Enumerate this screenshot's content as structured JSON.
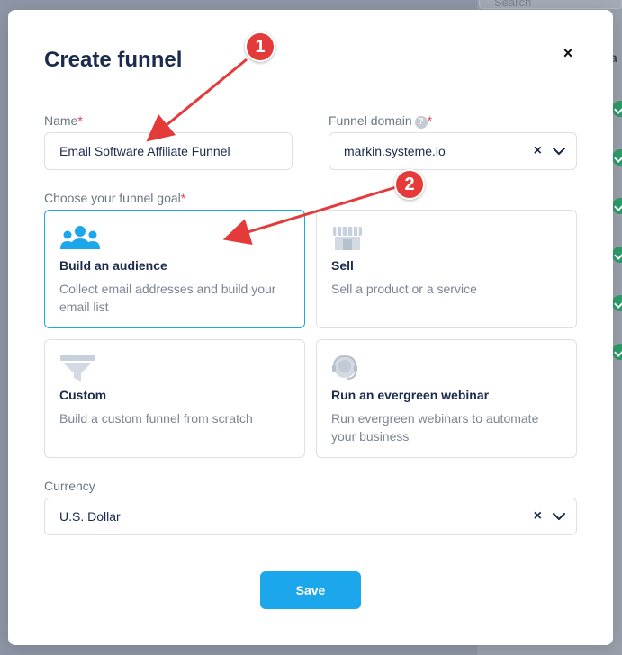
{
  "backdrop": {
    "search_placeholder": "Search",
    "partial_letter": "a"
  },
  "modal": {
    "title": "Create funnel",
    "close_glyph": "×"
  },
  "name_field": {
    "label": "Name",
    "required_mark": "*",
    "value": "Email Software Affiliate Funnel"
  },
  "domain_field": {
    "label": "Funnel domain",
    "help_glyph": "?",
    "required_mark": "*",
    "value": "markin.systeme.io",
    "clear_glyph": "×"
  },
  "goal": {
    "label": "Choose your funnel goal",
    "required_mark": "*",
    "options": [
      {
        "title": "Build an audience",
        "description": "Collect email addresses and build your email list",
        "icon": "audience-icon",
        "selected": true
      },
      {
        "title": "Sell",
        "description": "Sell a product or a service",
        "icon": "shop-icon",
        "selected": false
      },
      {
        "title": "Custom",
        "description": "Build a custom funnel from scratch",
        "icon": "funnel-icon",
        "selected": false
      },
      {
        "title": "Run an evergreen webinar",
        "description": "Run evergreen webinars to automate your business",
        "icon": "headset-icon",
        "selected": false
      }
    ]
  },
  "currency_field": {
    "label": "Currency",
    "value": "U.S. Dollar",
    "clear_glyph": "×"
  },
  "save_label": "Save",
  "annotations": [
    {
      "number": "1"
    },
    {
      "number": "2"
    }
  ],
  "colors": {
    "accent": "#1ca7ec",
    "selected_border": "#1ea7e1",
    "annotation": "#e53a3a",
    "title": "#1a2b4c"
  }
}
